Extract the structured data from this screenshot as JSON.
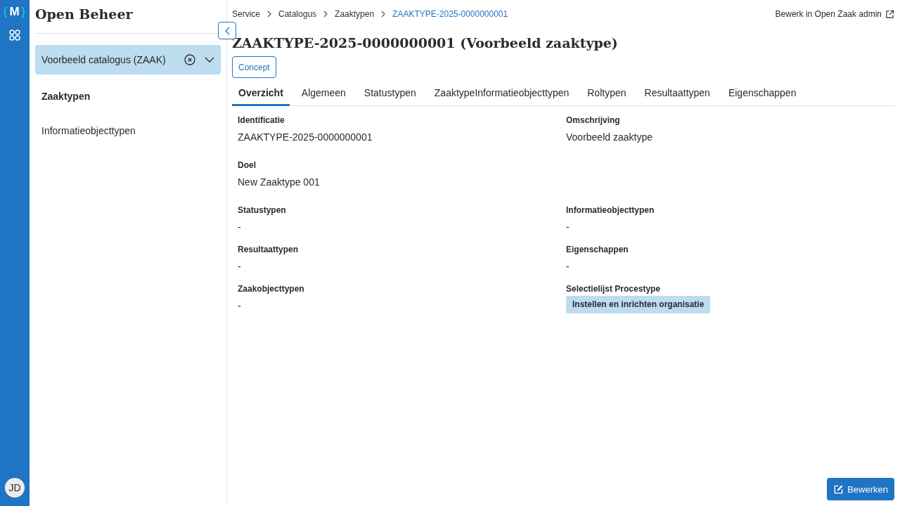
{
  "rail": {
    "logo": "{M}",
    "user_initials": "JD"
  },
  "sidebar": {
    "title": "Open Beheer",
    "catalog_select": {
      "value": "Voorbeeld catalogus (ZAAK)"
    },
    "items": [
      {
        "label": "Zaaktypen",
        "selected": true
      },
      {
        "label": "Informatieobjecttypen",
        "selected": false
      }
    ]
  },
  "breadcrumbs": [
    {
      "label": "Service",
      "current": false
    },
    {
      "label": "Catalogus",
      "current": false
    },
    {
      "label": "Zaaktypen",
      "current": false
    },
    {
      "label": "ZAAKTYPE-2025-0000000001",
      "current": true
    }
  ],
  "admin_link": "Bewerk in Open Zaak admin",
  "title": "ZAAKTYPE-2025-0000000001 (Voorbeeld zaaktype)",
  "status_badge": "Concept",
  "tabs": [
    {
      "label": "Overzicht",
      "selected": true
    },
    {
      "label": "Algemeen",
      "selected": false
    },
    {
      "label": "Statustypen",
      "selected": false
    },
    {
      "label": "ZaaktypeInformatieobjecttypen",
      "selected": false
    },
    {
      "label": "Roltypen",
      "selected": false
    },
    {
      "label": "Resultaattypen",
      "selected": false
    },
    {
      "label": "Eigenschappen",
      "selected": false
    }
  ],
  "field_rows": [
    [
      {
        "label": "Identificatie",
        "value": "ZAAKTYPE-2025-0000000001",
        "kind": "text"
      },
      {
        "label": "Omschrijving",
        "value": "Voorbeeld zaaktype",
        "kind": "text"
      }
    ],
    [
      {
        "label": "Doel",
        "value": "New Zaaktype 001",
        "kind": "text"
      }
    ],
    [
      {
        "label": "Statustypen",
        "value": "-",
        "kind": "text"
      },
      {
        "label": "Informatieobjecttypen",
        "value": "-",
        "kind": "text"
      }
    ],
    [
      {
        "label": "Resultaattypen",
        "value": "-",
        "kind": "text"
      },
      {
        "label": "Eigenschappen",
        "value": "-",
        "kind": "text"
      }
    ],
    [
      {
        "label": "Zaakobjecttypen",
        "value": "-",
        "kind": "text"
      },
      {
        "label": "Selectielijst Procestype",
        "value": "Instellen en inrichten organisatie",
        "kind": "tag"
      }
    ]
  ],
  "edit_button": "Bewerken"
}
